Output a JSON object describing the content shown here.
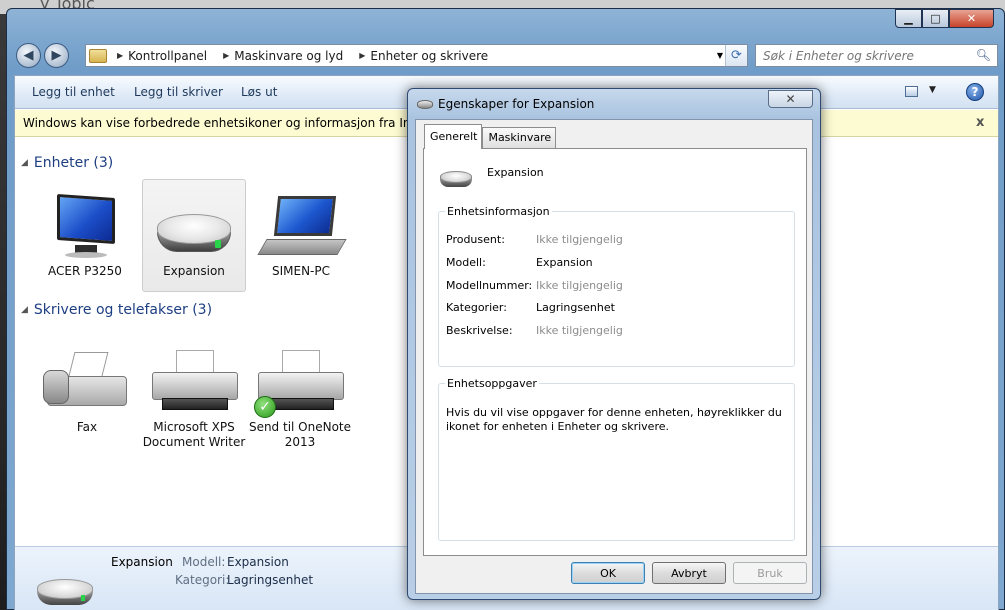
{
  "window": {
    "desk_text": "y Topic",
    "caption_buttons": {
      "minimize": "▁",
      "maximize": "□",
      "close": "✕"
    }
  },
  "nav": {
    "back": "◀",
    "forward": "▶",
    "breadcrumbs": [
      "Kontrollpanel",
      "Maskinvare og lyd",
      "Enheter og skrivere"
    ],
    "search_placeholder": "Søk i Enheter og skrivere"
  },
  "commandbar": {
    "add_device": "Legg til enhet",
    "add_printer": "Legg til skriver",
    "eject": "Løs ut",
    "help": "?"
  },
  "infobar": {
    "text": "Windows kan vise forbedrede enhetsikoner og informasjon fra Internett. K",
    "close": "x"
  },
  "groups": {
    "devices": {
      "title": "Enheter (3)",
      "items": [
        {
          "label": "ACER P3250",
          "icon": "monitor-icon"
        },
        {
          "label": "Expansion",
          "icon": "external-drive-icon",
          "selected": true
        },
        {
          "label": "SIMEN-PC",
          "icon": "laptop-icon"
        }
      ]
    },
    "printers": {
      "title": "Skrivere og telefakser (3)",
      "items": [
        {
          "label": "Fax",
          "icon": "fax-icon"
        },
        {
          "label_line1": "Microsoft XPS",
          "label_line2": "Document Writer",
          "icon": "printer-icon"
        },
        {
          "label_line1": "Send til OneNote",
          "label_line2": "2013",
          "icon": "printer-icon",
          "default": true
        }
      ]
    }
  },
  "details": {
    "name": "Expansion",
    "model_key": "Modell:",
    "model_val": "Expansion",
    "category_key": "Kategori:",
    "category_val": "Lagringsenhet"
  },
  "dialog": {
    "title": "Egenskaper for Expansion",
    "close": "✕",
    "tabs": [
      "Generelt",
      "Maskinvare"
    ],
    "device_name": "Expansion",
    "info_group": "Enhetsinformasjon",
    "rows": [
      {
        "key": "Produsent:",
        "value": "Ikke tilgjengelig",
        "na": true
      },
      {
        "key": "Modell:",
        "value": "Expansion",
        "na": false
      },
      {
        "key": "Modellnummer:",
        "value": "Ikke tilgjengelig",
        "na": true
      },
      {
        "key": "Kategorier:",
        "value": "Lagringsenhet",
        "na": false
      },
      {
        "key": "Beskrivelse:",
        "value": "Ikke tilgjengelig",
        "na": true
      }
    ],
    "tasks_group": "Enhetsoppgaver",
    "tasks_text": "Hvis du vil vise oppgaver for denne enheten, høyreklikker du ikonet for enheten i Enheter og skrivere.",
    "buttons": {
      "ok": "OK",
      "cancel": "Avbryt",
      "apply": "Bruk"
    }
  }
}
